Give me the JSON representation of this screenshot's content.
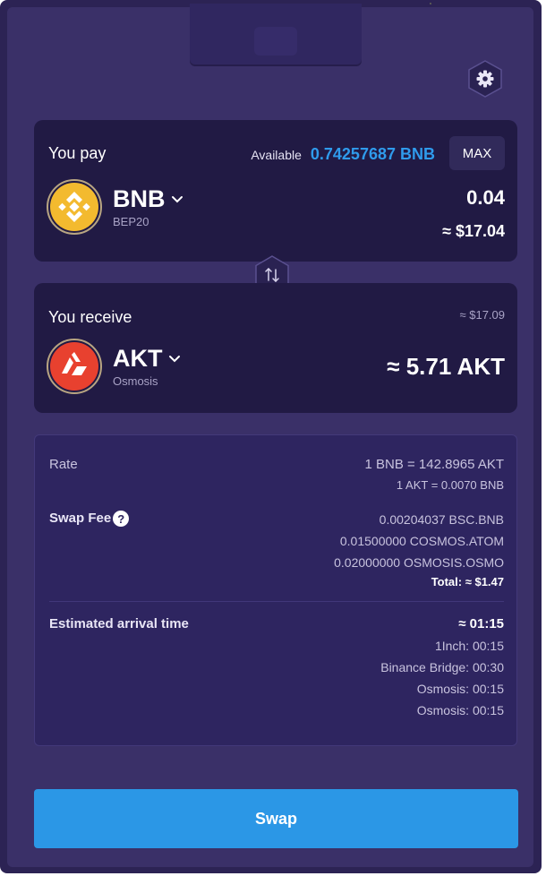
{
  "pay": {
    "title": "You pay",
    "available_label": "Available",
    "available_value": "0.74257687 BNB",
    "max_label": "MAX",
    "token_symbol": "BNB",
    "token_network": "BEP20",
    "amount": "0.04",
    "amount_usd": "≈ $17.04"
  },
  "receive": {
    "title": "You receive",
    "usd_estimate": "≈ $17.09",
    "token_symbol": "AKT",
    "token_network": "Osmosis",
    "amount": "≈ 5.71 AKT"
  },
  "details": {
    "rate_label": "Rate",
    "rate_line1": "1 BNB = 142.8965 AKT",
    "rate_line2": "1 AKT = 0.0070 BNB",
    "fee_label": "Swap Fee",
    "fee_lines": [
      "0.00204037 BSC.BNB",
      "0.01500000 COSMOS.ATOM",
      "0.02000000 OSMOSIS.OSMO"
    ],
    "fee_total": "Total: ≈ $1.47",
    "arrival_label": "Estimated arrival time",
    "arrival_total": "≈ 01:15",
    "arrival_steps": [
      "1Inch: 00:15",
      "Binance Bridge: 00:30",
      "Osmosis: 00:15",
      "Osmosis: 00:15"
    ]
  },
  "swap_button_label": "Swap",
  "icons": {
    "settings": "gear-icon",
    "swap_direction": "swap-arrows-icon",
    "help": "question-circle-icon",
    "pay_token": "bnb-logo",
    "receive_token": "akt-logo"
  },
  "colors": {
    "accent": "#2b97e6",
    "available": "#2f9bec",
    "background": "#3a3068",
    "card": "#211a44",
    "bnb": "#f3ba2f",
    "akt": "#e8412f"
  }
}
